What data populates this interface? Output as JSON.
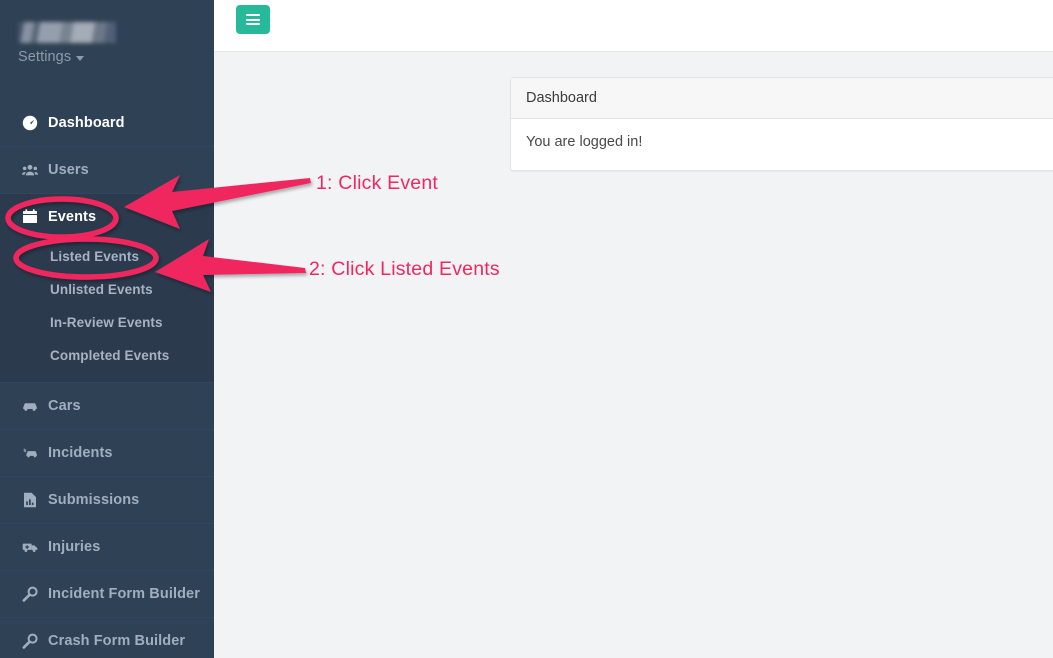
{
  "sidebar": {
    "profile": {
      "name_redacted": "",
      "settings_label": "Settings"
    },
    "items": [
      {
        "label": "Dashboard",
        "icon": "dashboard-icon",
        "active": true
      },
      {
        "label": "Users",
        "icon": "users-icon",
        "active": false
      },
      {
        "label": "Events",
        "icon": "calendar-icon",
        "active": true
      },
      {
        "label": "Cars",
        "icon": "car-icon",
        "active": false
      },
      {
        "label": "Incidents",
        "icon": "car-crash-icon",
        "active": false
      },
      {
        "label": "Submissions",
        "icon": "file-chart-icon",
        "active": false
      },
      {
        "label": "Injuries",
        "icon": "ambulance-icon",
        "active": false
      },
      {
        "label": "Incident Form Builder",
        "icon": "wrench-icon",
        "active": false
      },
      {
        "label": "Crash Form Builder",
        "icon": "wrench-icon",
        "active": false
      }
    ],
    "events_submenu": [
      {
        "label": "Listed Events"
      },
      {
        "label": "Unlisted Events"
      },
      {
        "label": "In-Review Events"
      },
      {
        "label": "Completed Events"
      }
    ]
  },
  "topbar": {
    "menu_toggle_icon": "hamburger-icon"
  },
  "panel": {
    "title": "Dashboard",
    "body_text": "You are logged in!"
  },
  "annotations": [
    {
      "label": "1: Click Event"
    },
    {
      "label": "2: Click Listed Events"
    }
  ],
  "colors": {
    "sidebar_bg": "#2f4154",
    "sidebar_group_bg": "#2b3a4d",
    "accent_teal": "#26b99a",
    "annotation_pink": "#f0285f",
    "content_bg": "#f2f3f5"
  }
}
